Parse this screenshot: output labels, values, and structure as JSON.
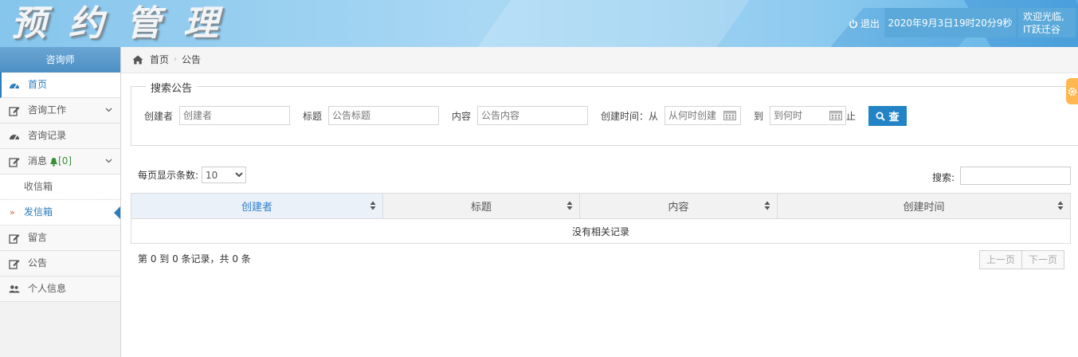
{
  "header": {
    "logo_text": "预约管理",
    "logout_label": "退出",
    "datetime": "2020年9月3日19时20分9秒",
    "welcome_line1": "欢迎光临,",
    "welcome_line2": "IT跃迁谷"
  },
  "sidebar": {
    "title": "咨询师",
    "items": [
      {
        "label": "首页",
        "icon": "dashboard-icon",
        "active": true
      },
      {
        "label": "咨询工作",
        "icon": "edit-icon",
        "expandable": true
      },
      {
        "label": "咨询记录",
        "icon": "dashboard-icon"
      },
      {
        "label": "消息",
        "icon": "edit-icon",
        "expandable": true,
        "badge": "[0]"
      },
      {
        "label": "留言",
        "icon": "edit-icon"
      },
      {
        "label": "公告",
        "icon": "edit-icon"
      },
      {
        "label": "个人信息",
        "icon": "users-icon"
      }
    ],
    "subitems": [
      {
        "label": "收信箱"
      },
      {
        "label": "发信箱",
        "active": true
      }
    ]
  },
  "breadcrumb": {
    "home": "首页",
    "current": "公告"
  },
  "search": {
    "legend": "搜索公告",
    "creator_label": "创建者",
    "creator_placeholder": "创建者",
    "title_label": "标题",
    "title_placeholder": "公告标题",
    "content_label": "内容",
    "content_placeholder": "公告内容",
    "time_label": "创建时间：从",
    "from_placeholder": "从何时创建",
    "to_label": "到",
    "to_placeholder": "到何时",
    "end_label": "止",
    "button_label": "查"
  },
  "table": {
    "pagesize_label": "每页显示条数:",
    "pagesize_value": "10",
    "search_label": "搜索:",
    "columns": [
      "创建者",
      "标题",
      "内容",
      "创建时间"
    ],
    "empty_text": "没有相关记录",
    "info": "第 0 到 0 条记录，共 0 条",
    "prev": "上一页",
    "next": "下一页"
  },
  "colors": {
    "accent": "#2283c5",
    "sidebar_header": "#5a98c9",
    "settings_tab": "#ffb752"
  }
}
